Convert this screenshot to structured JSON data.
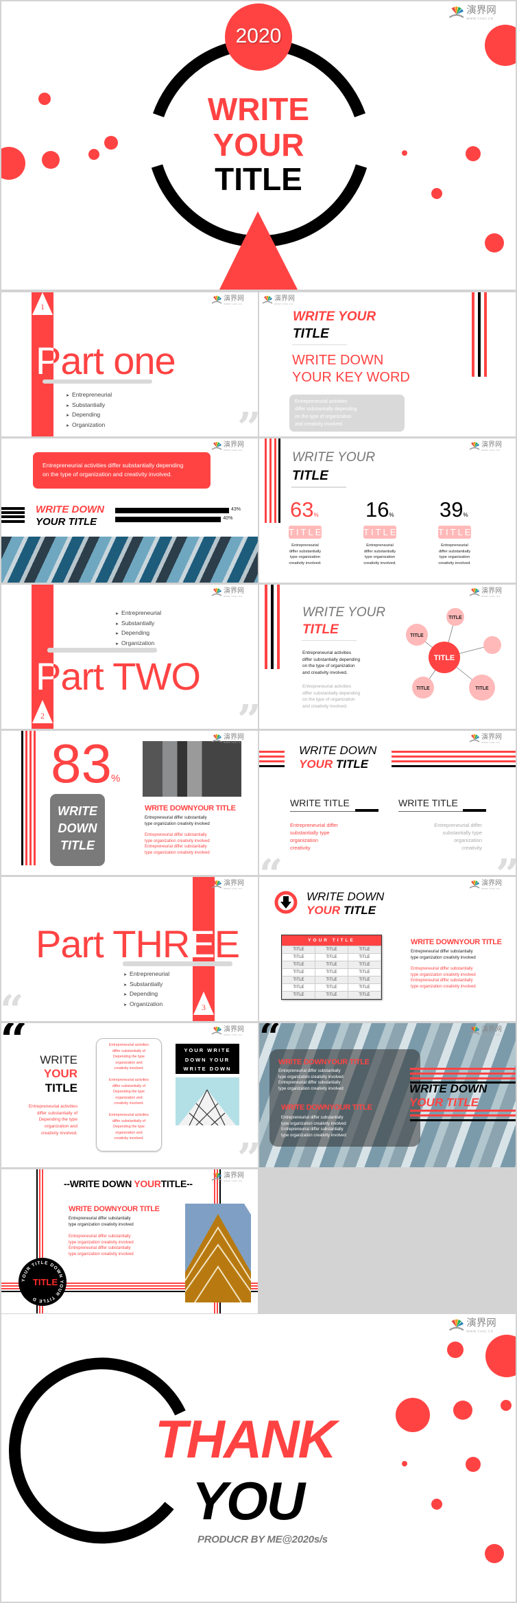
{
  "colors": {
    "accent": "#ff4343",
    "pink": "#ffb9b9",
    "black": "#000000",
    "gray": "#d9d9d9"
  },
  "logo": {
    "name": "演界网",
    "url_text": "WWW.YANJ.CN",
    "icon": "fan-logo-icon"
  },
  "cover": {
    "year": "2020",
    "line1": "WRITE",
    "line2": "YOUR",
    "line3": "TITLE"
  },
  "part_one": {
    "number": "1",
    "title": "Part one",
    "bullets": [
      "Entrepreneurial",
      "Substantially",
      "Depending",
      "Organization"
    ]
  },
  "keyword_slide": {
    "title1": "WRITE YOUR",
    "title2": "TITLE",
    "key1": "WRITE DOWN",
    "key2": "YOUR KEY WORD",
    "body": [
      "Entrepreneurial activities",
      "differ substantially depending",
      "on the type of organization",
      "and creativity involved."
    ]
  },
  "bars_slide": {
    "banner": [
      "Entrepreneurial activities differ substantially depending",
      "on the type of organization and creativity involved."
    ],
    "title1": "WRITE DOWN",
    "title2": "YOUR TITLE",
    "bars": [
      {
        "label": "43%",
        "value": 43
      },
      {
        "label": "40%",
        "value": 40
      }
    ]
  },
  "stats_slide": {
    "title1": "WRITE YOUR",
    "title2": "TITLE",
    "stats": [
      {
        "value": "63",
        "unit": "%",
        "badge": "TITLE",
        "desc": [
          "Entrepreneurial",
          "differ substantially",
          "type organization",
          "creativity involved."
        ]
      },
      {
        "value": "16",
        "unit": "%",
        "badge": "TITLE",
        "desc": [
          "Entrepreneurial",
          "differ substantially",
          "type organization",
          "creativity involved."
        ]
      },
      {
        "value": "39",
        "unit": "%",
        "badge": "TITLE",
        "desc": [
          "Entrepreneurial",
          "differ substantially",
          "type organization",
          "creativity involved."
        ]
      }
    ]
  },
  "part_two": {
    "number": "2",
    "title": "Part TWO",
    "bullets": [
      "Entrepreneurial",
      "Substantially",
      "Depending",
      "Organization"
    ]
  },
  "bubble_slide": {
    "title1": "WRITE YOUR",
    "title2": "TITLE",
    "body": [
      "Entrepreneurial activities",
      "differ substantially depending",
      "on the type of organization",
      "and creativity involved."
    ],
    "body_gray": [
      "Entrepreneurial activities",
      "differ substantially depending",
      "on the type of organization",
      "and creativity involved."
    ],
    "center": "TITLE",
    "nodes": [
      "TITLE",
      "TITLE",
      "",
      "TITLE",
      "TITLE"
    ]
  },
  "percent_slide": {
    "value": "83",
    "unit": "%",
    "box": [
      "WRITE",
      "DOWN",
      "TITLE"
    ],
    "heading": "WRITE DOWNYOUR TITLE",
    "dark": [
      "Entrepreneurial differ substantially",
      "type organization creativity involved"
    ],
    "red": [
      "Entrepreneurial differ substantially",
      "type organization creativity involved",
      "Entrepreneurial differ substantially",
      "type organization creativity involved"
    ]
  },
  "two_col_slide": {
    "title1": "WRITE DOWN",
    "title2a": "YOUR",
    "title2b": "TITLE",
    "cols": [
      {
        "title": "WRITE TITLE",
        "lines": [
          "Entrepreneurial differ",
          "substantially type",
          "organization",
          "creativity"
        ]
      },
      {
        "title": "WRITE TITLE",
        "lines": [
          "Entrepreneurial differ",
          "substantially type",
          "organization",
          "creativity"
        ]
      }
    ]
  },
  "part_three": {
    "number": "3",
    "title": "Part THREE",
    "bullets": [
      "Entrepreneurial",
      "Substantially",
      "Depending",
      "Organization"
    ]
  },
  "table_slide": {
    "title1": "WRITE DOWN",
    "title2a": "YOUR",
    "title2b": "TITLE",
    "table_header": "YOUR TITLE",
    "rows": [
      [
        "TITLE",
        "TITLE",
        "TITLE"
      ],
      [
        "TITLE",
        "TITLE",
        "TITLE"
      ],
      [
        "TITLE",
        "TITLE",
        "TITLE"
      ],
      [
        "TITLE",
        "TITLE",
        "TITLE"
      ],
      [
        "TITLE",
        "TITLE",
        "TITLE"
      ],
      [
        "TITLE",
        "TITLE",
        "TITLE"
      ],
      [
        "TITLE",
        "TITLE",
        "TITLE"
      ]
    ],
    "heading": "WRITE DOWNYOUR TITLE",
    "dark": [
      "Entrepreneurial differ substantially",
      "type organization creativity involved"
    ],
    "red": [
      "Entrepreneurial differ substantially",
      "type organization creativity involved",
      "Entrepreneurial differ substantially",
      "type organization creativity involved"
    ]
  },
  "quote_slide": {
    "t1": "WRITE",
    "t2": "YOUR",
    "t3": "TITLE",
    "left_text": [
      "Entrepreneurial activities",
      "differ substantially of",
      "Depending the type",
      "organization and",
      "creativity involved."
    ],
    "box_paras": [
      [
        "Entrepreneurial activities",
        "differ substantially of",
        "Depending the type",
        "organization and",
        "creativity involved."
      ],
      [
        "Entrepreneurial activities",
        "differ substantially of",
        "Depending the type",
        "organization and",
        "creativity involved."
      ],
      [
        "Entrepreneurial activities",
        "differ substantially of",
        "Depending the type",
        "organization and",
        "creativity involved."
      ]
    ],
    "black_box": [
      "YOUR WRITE",
      "DOWN YOUR",
      "WRITE DOWN"
    ]
  },
  "photo_slide": {
    "blocks": [
      {
        "heading": "WRITE DOWNYOUR TITLE",
        "lines": [
          "Entrepreneurial differ substantially",
          "type organization creativity involved",
          "Entrepreneurial differ substantially",
          "type organization creativity involved"
        ]
      },
      {
        "heading": "WRITE DOWNYOUR TITLE",
        "lines": [
          "Entrepreneurial differ substantially",
          "type organization creativity involved",
          "Entrepreneurial differ substantially",
          "type organization creativity involved"
        ]
      }
    ],
    "title1": "WRITE DOWN",
    "title2": "YOUR TITLE"
  },
  "frame_slide": {
    "title_a": "--WRITE DOWN ",
    "title_b": "YOUR",
    "title_c": "TITLE--",
    "heading": "WRITE DOWNYOUR TITLE",
    "dark": [
      "Entrepreneurial differ substantially",
      "type organization creativity involved"
    ],
    "red": [
      "Entrepreneurial differ substantially",
      "type organization creativity involved",
      "Entrepreneurial differ substantially",
      "type organization creativity involved"
    ],
    "badge": "TITLE",
    "badge_ring": "YOUR TITLE DOWN YOUR TITLE D"
  },
  "thanks": {
    "line1": "THANK",
    "line2": "YOU",
    "credit": "PRODUCR BY ME@2020s/s"
  }
}
